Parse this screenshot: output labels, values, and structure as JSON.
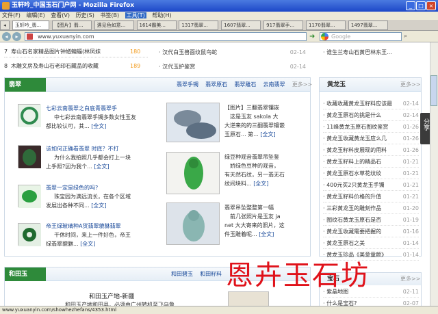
{
  "window": {
    "title": "玉轩吟_中国玉石门户网 - Mozilla Firefox"
  },
  "menu": [
    "文件(F)",
    "编辑(E)",
    "查看(V)",
    "历史(S)",
    "书签(B)",
    "工具(T)",
    "帮助(H)"
  ],
  "tabs": [
    "玉轩吟_翡...",
    "【图片】翡...",
    "遇见色如意...",
    "1614霸美...",
    "1317翡翠...",
    "1607翡翠...",
    "917翡翠手...",
    "1170翡翠...",
    "1497翡翠..."
  ],
  "url": "www.yuxuanyin.com",
  "search_placeholder": "Google",
  "top_rank": [
    {
      "n": "7",
      "t": "寿山石名家精品图片钟馗蝙蝠(林凤妹",
      "v": "180"
    },
    {
      "n": "8",
      "t": "木雕文房及寿山石老印石藏品的收藏",
      "v": "189"
    }
  ],
  "top_mid": [
    {
      "t": "汉代白玉兽面纹鼠鸟蛇",
      "d": "02-14"
    },
    {
      "t": "汉代玉护鉴赏",
      "d": "02-14"
    }
  ],
  "top_right": "谁生兰寿山石黄巴林东王...",
  "fc": {
    "title": "翡翠",
    "links": [
      "翡翠手镯",
      "翡翠原石",
      "翡翠雕石",
      "云南翡翠"
    ],
    "more": "更多>>"
  },
  "fc_items": [
    {
      "l1": "七彩云南翡翠之白底青翡翠手",
      "l2": "中七彩云南翡翠手镯多数女性玉友",
      "l3": "都比较认可，其...",
      "full": "[全文]"
    },
    {
      "l1": "该如何正确看翡翠 时底？不打",
      "l2": "为什么我拍照几乎都会打上一块",
      "l3": "上手照?因为我个...",
      "full": "[全文]"
    },
    {
      "l1": "翡翠一定是绿色的吗?",
      "l2": "珠宝园为满远流长，在各个区域",
      "l3": "发展出各种不同...",
      "full": "[全文]"
    },
    {
      "l1": "帝王绿玻璃种A货翡翠貔貅翡翠",
      "l2": "干休时间，来上一件好色，帝王",
      "l3": "绿翡翠貔貅...",
      "full": "[全文]"
    }
  ],
  "fc_mid": [
    {
      "l1": "【图片】三翻翡翠镶嵌",
      "l2": "这是玉友 sakola 大",
      "l3": "大逆来的的三翻翡翠镶嵌",
      "l4": "玉原石... 第...",
      "full": "[全文]"
    },
    {
      "l1": "绿豆种观音翡翠吊坠鉴",
      "l2": "娇绿色豆种的观音，",
      "l3": "有天然石纹，另一翡无石",
      "l4": "纹间块料...",
      "full": "[全文]"
    },
    {
      "l1": "翡翠吊坠整整第一幅",
      "l2": "前几张照片是玉友 ja",
      "l3": "net 大大寄来的照片，这",
      "l4": "件玉雕着呢...",
      "full": "[全文]"
    }
  ],
  "hly": {
    "title": "黄龙玉",
    "more": "更多>>"
  },
  "hly_list": [
    {
      "t": "收藏收藏黄龙玉籽料应该最",
      "d": "02-14"
    },
    {
      "t": "黄龙玉原石的挑是什么",
      "d": "02-14"
    },
    {
      "t": "11峰黄龙玉原石图纹鉴赏",
      "d": "01-26"
    },
    {
      "t": "黄龙玉收藏黄龙玉应么几",
      "d": "01-26"
    },
    {
      "t": "黄龙玉籽料皮展现的用料",
      "d": "01-26"
    },
    {
      "t": "黄龙玉籽料上的精品石",
      "d": "01-21"
    },
    {
      "t": "黄龙玉原石水草花纹纹",
      "d": "01-21"
    },
    {
      "t": "400元买2只黄龙玉手镯",
      "d": "01-21"
    },
    {
      "t": "黄龙玉籽料价格的升值",
      "d": "01-21"
    },
    {
      "t": "三彩黄龙玉的雕刻作品",
      "d": "01-20"
    },
    {
      "t": "图纹石黄龙玉原石是否",
      "d": "01-19"
    },
    {
      "t": "黄龙玉收藏需要把握的",
      "d": "01-16"
    },
    {
      "t": "黄龙玉原石之美",
      "d": "01-14"
    },
    {
      "t": "黄龙玉珍品《美意童颜》",
      "d": "01-14"
    }
  ],
  "share": "分享",
  "hty": {
    "title": "和田玉",
    "links": [
      "和田碧玉",
      "和田籽料"
    ],
    "sub": "和田玉产地-新疆",
    "line": "和田玉产地和田县，必须由广州转机至飞乌鲁"
  },
  "baoshi": {
    "title": "宝石",
    "more": "更多>>",
    "items": [
      {
        "t": "紫晶地图",
        "d": "02-11"
      },
      {
        "t": "什么是宝石?",
        "d": "02-07"
      }
    ]
  },
  "watermark": "恩卉玉石坊",
  "status_url": "www.yuxuanyin.com/showhezhefans/4353.html",
  "colors": {
    "accent": "#2e8a3a",
    "title": "#1a4a9a",
    "watermark": "#e0121a"
  }
}
